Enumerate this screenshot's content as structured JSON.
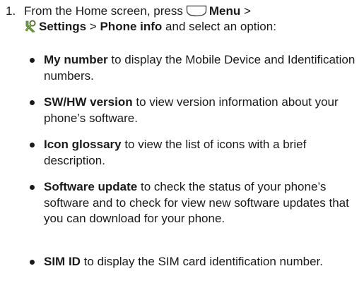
{
  "step": {
    "number": "1.",
    "intro": "From the Home screen, press",
    "menu": "Menu",
    "sep1": ">",
    "settings": "Settings",
    "sep2": ">",
    "phone_info": "Phone info",
    "tail": "and select an option:"
  },
  "options": [
    {
      "term": "My number",
      "desc": " to display the Mobile Device and Identification numbers."
    },
    {
      "term": "SW/HW version",
      "desc": " to view version information about your phone’s software."
    },
    {
      "term": "Icon glossary",
      "desc": " to view the list of icons with a brief description."
    },
    {
      "term": "Software update",
      "desc": " to check the status of your phone’s software and to check for view new software updates that you can download for your phone."
    },
    {
      "term": "SIM ID",
      "desc": " to display the SIM card identification number."
    }
  ],
  "icons": {
    "menu_key": "menu-key-icon",
    "settings": "settings-icon",
    "bullet": "bullet-icon"
  },
  "colors": {
    "text": "#1a1a1a",
    "key_fill": "#ffffff",
    "key_stroke": "#3a3a3a",
    "settings_green": "#6fa83a",
    "settings_dark": "#4d6b2a"
  }
}
